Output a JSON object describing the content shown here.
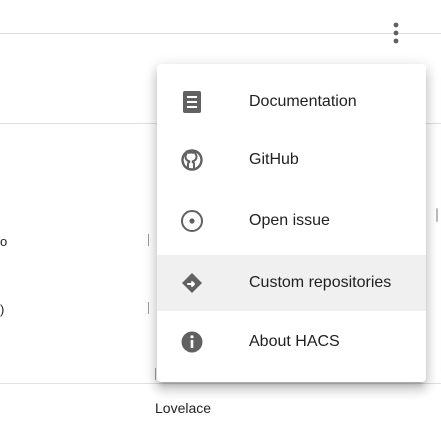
{
  "menu": {
    "items": [
      {
        "label": "Documentation",
        "icon": "book-icon"
      },
      {
        "label": "GitHub",
        "icon": "github-icon"
      },
      {
        "label": "Open issue",
        "icon": "alert-circle-outline-icon"
      },
      {
        "label": "Custom repositories",
        "icon": "diamond-arrow-icon"
      },
      {
        "label": "About HACS",
        "icon": "information-icon"
      }
    ],
    "active_index": 3
  },
  "background": {
    "left_text_a": "o",
    "left_text_b": ")",
    "lower_label": "Lovelace"
  },
  "colors": {
    "icon": "#616161",
    "text": "#212121",
    "active_bg": "#f0f0f0",
    "divider": "#e0e0e0"
  }
}
